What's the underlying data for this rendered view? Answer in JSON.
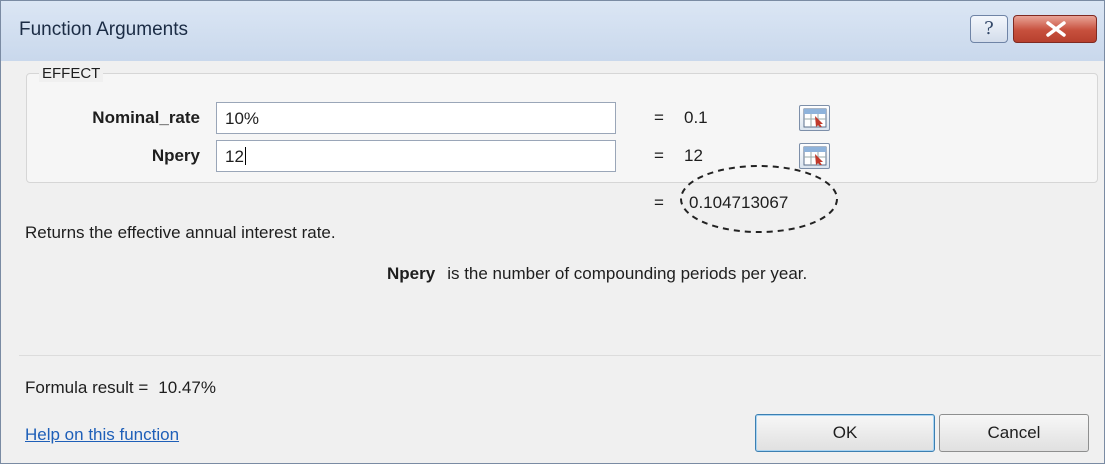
{
  "window": {
    "title": "Function Arguments"
  },
  "function_name": "EFFECT",
  "arguments": [
    {
      "label": "Nominal_rate",
      "value": "10%",
      "result": "0.1"
    },
    {
      "label": "Npery",
      "value": "12",
      "result": "12"
    }
  ],
  "eq_sign": "=",
  "final_result": "0.104713067",
  "description": "Returns the effective annual interest rate.",
  "arg_help": {
    "name": "Npery",
    "text": "is the number of compounding periods per year."
  },
  "formula_result": {
    "label": "Formula result =",
    "value": "10.47%"
  },
  "help_link": "Help on this function",
  "buttons": {
    "ok": "OK",
    "cancel": "Cancel",
    "help": "?"
  },
  "icons": {
    "help": "question-icon",
    "close": "close-icon",
    "ref": "range-select-icon"
  }
}
